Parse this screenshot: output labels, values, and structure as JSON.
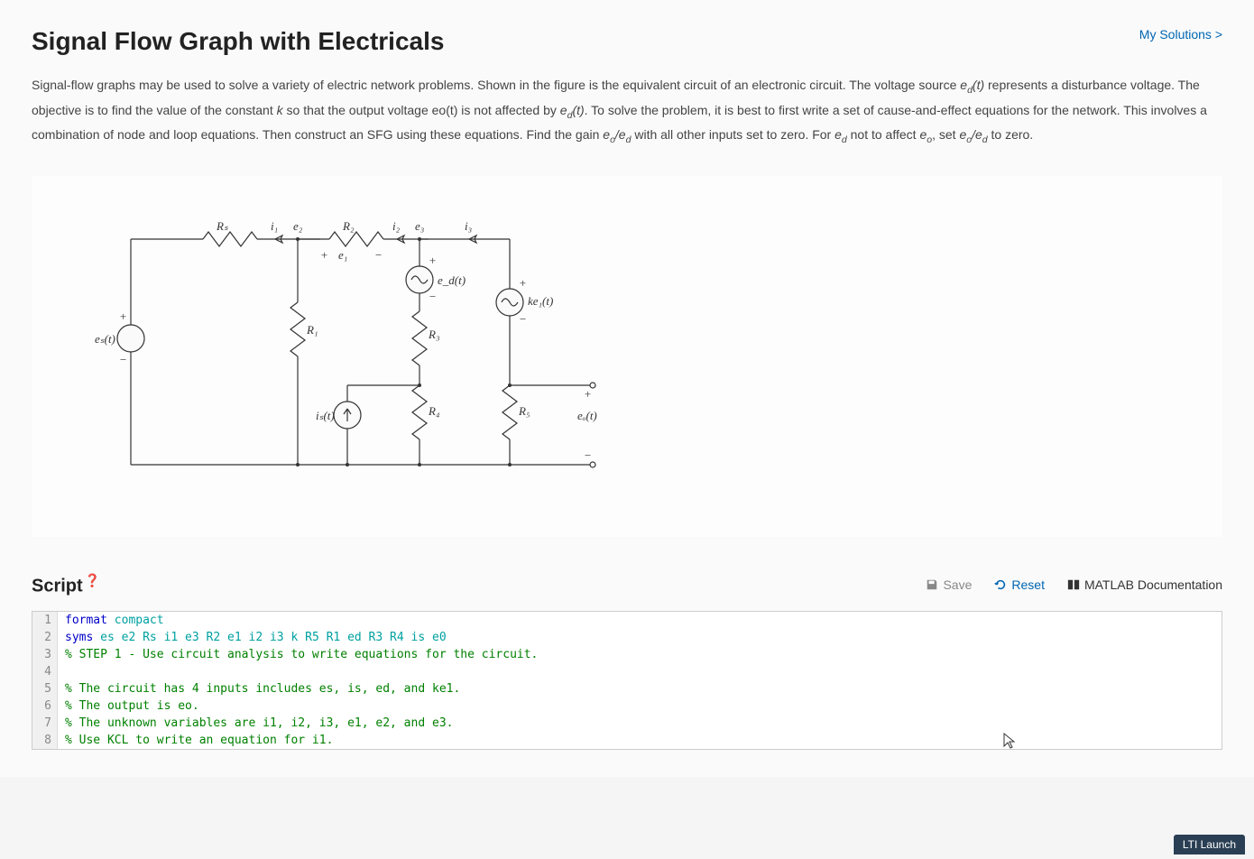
{
  "header": {
    "title": "Signal Flow Graph with Electricals",
    "my_solutions": "My Solutions >"
  },
  "description": {
    "text_html": "Signal-flow graphs may be used to solve a variety of electric network problems. Shown in the figure is the equivalent circuit of an electronic circuit. The voltage source e_d(t) represents a disturbance voltage. The objective is to find the value of the constant k so that the output voltage eo(t) is not affected by e_d(t). To solve the problem, it is best to first write a set of cause-and-effect equations for the network. This involves a combination of node and loop equations. Then construct an SFG using these equations. Find the gain e_o/e_d with all other inputs set to zero. For e_d not to affect e_o, set e_o/e_d to zero."
  },
  "circuit": {
    "sources": {
      "es": "e_s(t)",
      "ed": "e_d(t)",
      "is": "i_s(t)",
      "ke1": "ke_1(t)",
      "eo": "e_o(t)"
    },
    "resistors": {
      "Rs": "R_s",
      "R1": "R_1",
      "R2": "R_2",
      "R3": "R_3",
      "R4": "R_4",
      "R5": "R_5"
    },
    "nodes": {
      "e1": "e_1",
      "e2": "e_2",
      "e3": "e_3"
    },
    "currents": {
      "i1": "i_1",
      "i2": "i_2",
      "i3": "i_3"
    }
  },
  "script_panel": {
    "title": "Script",
    "save": "Save",
    "reset": "Reset",
    "docs": "MATLAB Documentation"
  },
  "code": {
    "lines": [
      {
        "n": 1,
        "tokens": [
          {
            "t": "format ",
            "c": "keyword"
          },
          {
            "t": "compact",
            "c": "var"
          }
        ]
      },
      {
        "n": 2,
        "tokens": [
          {
            "t": "syms ",
            "c": "keyword"
          },
          {
            "t": "es e2 Rs i1 e3 R2 e1 i2 i3 k R5 R1 ed R3 R4 is e0",
            "c": "var"
          }
        ]
      },
      {
        "n": 3,
        "tokens": [
          {
            "t": "% STEP 1 - Use circuit analysis to write equations for the circuit.",
            "c": "comment"
          }
        ]
      },
      {
        "n": 4,
        "tokens": [
          {
            "t": "",
            "c": ""
          }
        ]
      },
      {
        "n": 5,
        "tokens": [
          {
            "t": "% The circuit has 4 inputs includes es, is, ed, and ke1.",
            "c": "comment"
          }
        ]
      },
      {
        "n": 6,
        "tokens": [
          {
            "t": "% The output is eo.",
            "c": "comment"
          }
        ]
      },
      {
        "n": 7,
        "tokens": [
          {
            "t": "% The unknown variables are i1, i2, i3, e1, e2, and e3.",
            "c": "comment"
          }
        ]
      },
      {
        "n": 8,
        "tokens": [
          {
            "t": "% Use KCL to write an equation for i1.",
            "c": "comment"
          }
        ]
      }
    ]
  },
  "footer": {
    "lti": "LTI Launch"
  }
}
